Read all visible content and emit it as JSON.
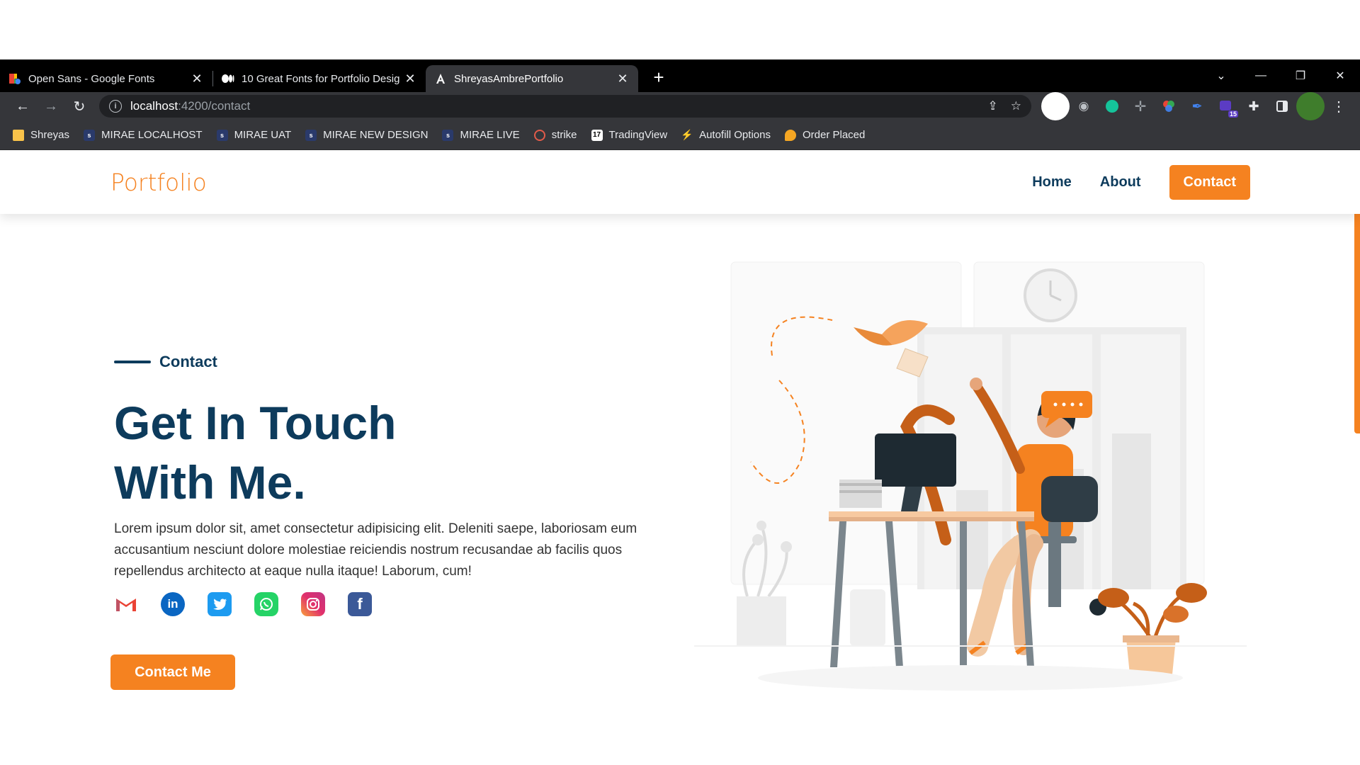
{
  "browser": {
    "tabs": [
      {
        "title": "Open Sans - Google Fonts",
        "icon": "google-fonts-icon"
      },
      {
        "title": "10 Great Fonts for Portfolio Desig",
        "icon": "medium-icon"
      },
      {
        "title": "ShreyasAmbrePortfolio",
        "icon": "angular-icon"
      }
    ],
    "url_host": "localhost",
    "url_path": ":4200/contact",
    "bookmarks": [
      {
        "label": "Shreyas",
        "icon": "folder-icon"
      },
      {
        "label": "MIRAE LOCALHOST",
        "icon": "stock-icon"
      },
      {
        "label": "MIRAE UAT",
        "icon": "stock-icon"
      },
      {
        "label": "MIRAE NEW DESIGN",
        "icon": "stock-icon"
      },
      {
        "label": "MIRAE LIVE",
        "icon": "stock-icon"
      },
      {
        "label": "strike",
        "icon": "strike-icon"
      },
      {
        "label": "TradingView",
        "icon": "tradingview-icon"
      },
      {
        "label": "Autofill Options",
        "icon": "autofill-icon"
      },
      {
        "label": "Order Placed",
        "icon": "order-icon"
      }
    ],
    "extension_badge": "15"
  },
  "site": {
    "logo": "Portfolio",
    "nav": {
      "home": "Home",
      "about": "About",
      "contact": "Contact"
    },
    "eyebrow": "Contact",
    "heading_line1": "Get In Touch",
    "heading_line2": "With Me.",
    "description": "Lorem ipsum dolor sit, amet consectetur adipisicing elit. Deleniti saepe, laboriosam eum accusantium nesciunt dolore molestiae reiciendis nostrum recusandae ab facilis quos repellendus architecto at eaque nulla itaque! Laborum, cum!",
    "socials": [
      "gmail-icon",
      "linkedin-icon",
      "twitter-icon",
      "whatsapp-icon",
      "instagram-icon",
      "facebook-icon"
    ],
    "cta": "Contact Me"
  },
  "colors": {
    "accent": "#f58220",
    "navy": "#0d3b5c"
  }
}
